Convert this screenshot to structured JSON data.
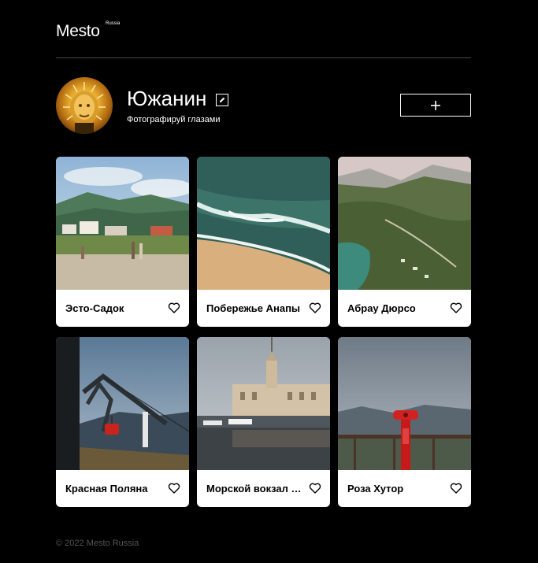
{
  "header": {
    "logo": "Mesto",
    "logo_sup": "Russia"
  },
  "profile": {
    "name": "Южанин",
    "about": "Фотографируй глазами",
    "add_button_label": "+"
  },
  "cards": [
    {
      "title": "Эсто-Садок"
    },
    {
      "title": "Побережье Анапы"
    },
    {
      "title": "Абрау Дюрсо"
    },
    {
      "title": "Красная Поляна"
    },
    {
      "title": "Морской вокзал Сочи"
    },
    {
      "title": "Роза Хутор"
    }
  ],
  "footer": {
    "copyright": "© 2022 Mesto Russia"
  },
  "colors": {
    "background": "#000000",
    "card": "#ffffff",
    "divider": "#4a4a4a",
    "footer_text": "#545454"
  }
}
